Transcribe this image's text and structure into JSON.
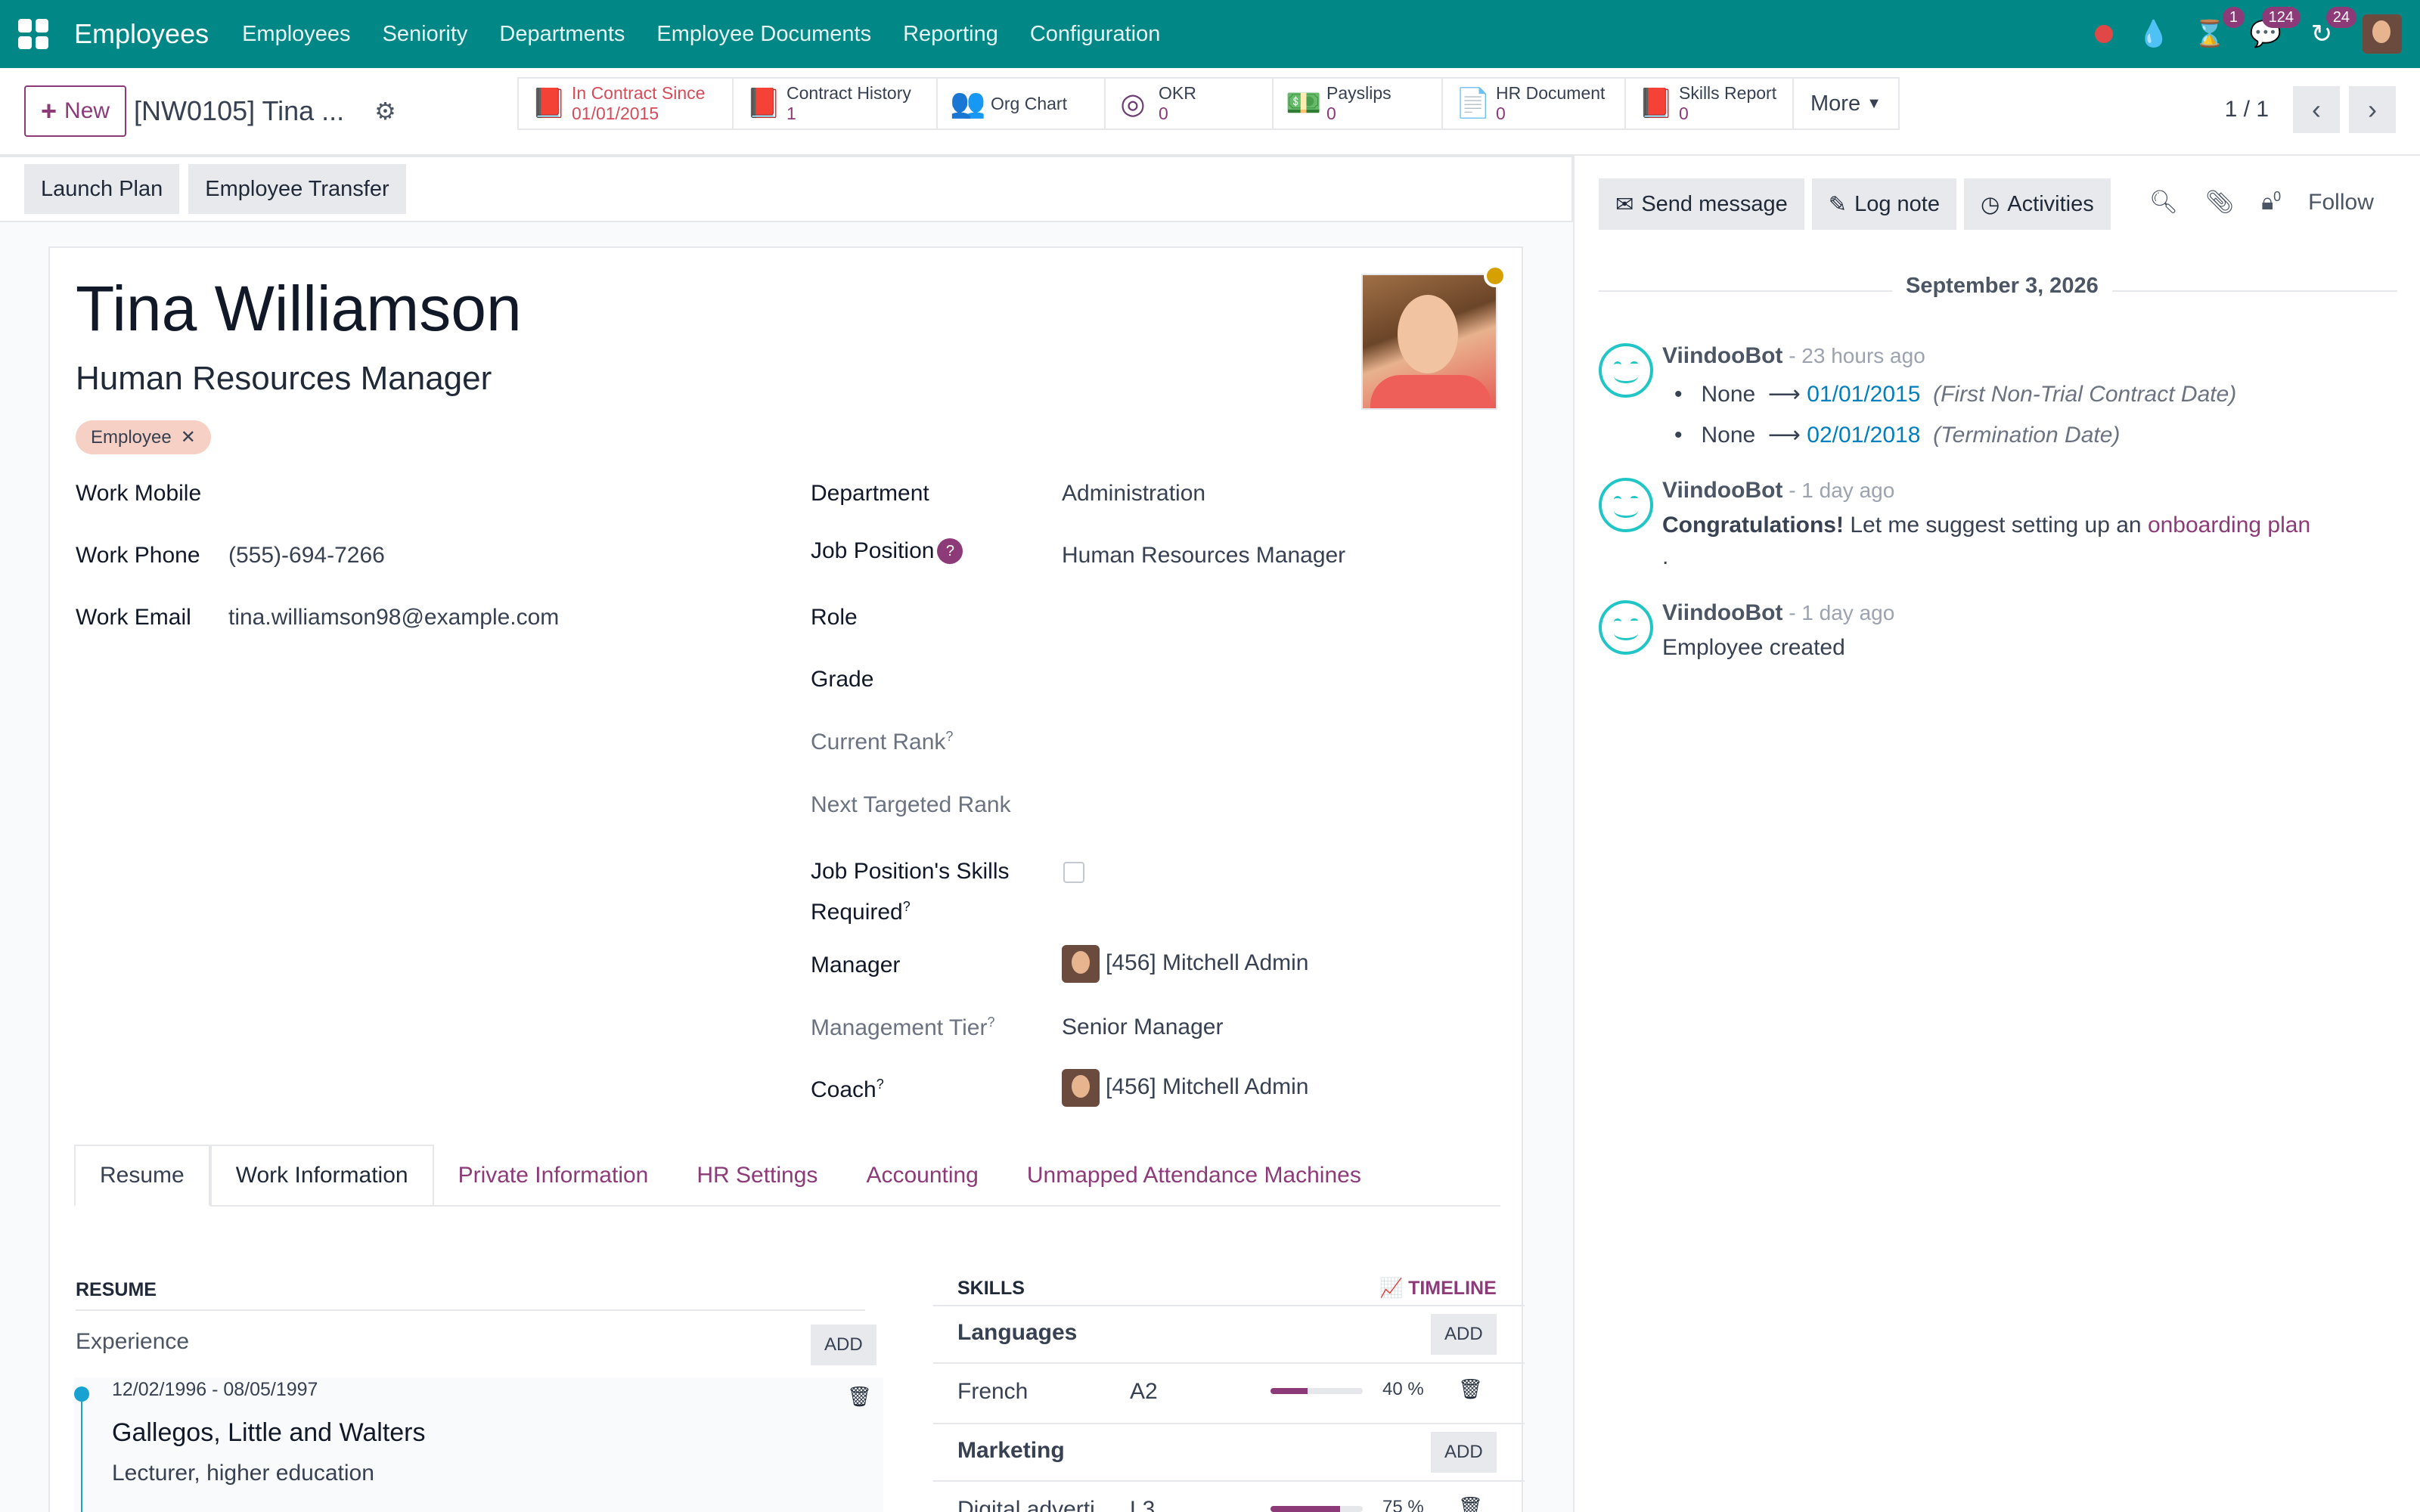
{
  "navbar": {
    "app_name": "Employees",
    "menu": [
      "Employees",
      "Seniority",
      "Departments",
      "Employee Documents",
      "Reporting",
      "Configuration"
    ],
    "badges": {
      "activities": "1",
      "messages": "124",
      "updates": "24"
    },
    "accent": "#018786"
  },
  "control": {
    "new_label": "New",
    "record_title": "[NW0105] Tina ...",
    "smart_buttons": [
      {
        "icon": "book-icon",
        "label": "In Contract Since",
        "value": "01/01/2015"
      },
      {
        "icon": "book-icon",
        "label": "Contract History",
        "value": "1"
      },
      {
        "icon": "users-icon",
        "label": "Org Chart",
        "value": ""
      },
      {
        "icon": "target-icon",
        "label": "OKR",
        "value": "0"
      },
      {
        "icon": "money-icon",
        "label": "Payslips",
        "value": "0"
      },
      {
        "icon": "file-icon",
        "label": "HR Document",
        "value": "0"
      },
      {
        "icon": "book-icon",
        "label": "Skills Report",
        "value": "0"
      }
    ],
    "more_label": "More",
    "pager": "1 / 1"
  },
  "statusbar": {
    "launch_plan": "Launch Plan",
    "employee_transfer": "Employee Transfer"
  },
  "employee": {
    "name": "Tina Williamson",
    "job_title": "Human Resources Manager",
    "tag": "Employee"
  },
  "fields_left": {
    "work_mobile_label": "Work Mobile",
    "work_phone_label": "Work Phone",
    "work_phone": "(555)-694-7266",
    "work_email_label": "Work Email",
    "work_email": "tina.williamson98@example.com"
  },
  "fields_right": {
    "department_label": "Department",
    "department": "Administration",
    "job_position_label": "Job Position",
    "job_position": "Human Resources Manager",
    "role_label": "Role",
    "grade_label": "Grade",
    "current_rank_label": "Current Rank",
    "next_rank_label": "Next Targeted Rank",
    "skills_required_label_1": "Job Position's Skills",
    "skills_required_label_2": "Required",
    "manager_label": "Manager",
    "manager": "[456] Mitchell Admin",
    "management_tier_label": "Management Tier",
    "management_tier": "Senior Manager",
    "coach_label": "Coach",
    "coach": "[456] Mitchell Admin"
  },
  "tabs": [
    "Resume",
    "Work Information",
    "Private Information",
    "HR Settings",
    "Accounting",
    "Unmapped Attendance Machines"
  ],
  "resume": {
    "heading": "RESUME",
    "experience_label": "Experience",
    "add_label": "ADD",
    "entry": {
      "dates": "12/02/1996 - 08/05/1997",
      "company": "Gallegos, Little and Walters",
      "role": "Lecturer, higher education"
    }
  },
  "skills": {
    "heading": "SKILLS",
    "timeline_label": "TIMELINE",
    "groups": [
      {
        "name": "Languages",
        "add": "ADD",
        "rows": [
          {
            "skill": "French",
            "level": "A2",
            "progress": 40,
            "percent": "40 %"
          }
        ]
      },
      {
        "name": "Marketing",
        "add": "ADD",
        "rows": [
          {
            "skill": "Digital adverti...",
            "level": "L3",
            "progress": 75,
            "percent": "75 %"
          }
        ]
      }
    ]
  },
  "chatter": {
    "send_message": "Send message",
    "log_note": "Log note",
    "activities": "Activities",
    "followers_count": "0",
    "follow_label": "Follow",
    "date": "September 3, 2026",
    "messages": [
      {
        "author": "ViindooBot",
        "when": " - 23 hours ago",
        "changes": [
          {
            "old": "None",
            "new": "01/01/2015",
            "field": "(First Non-Trial Contract Date)"
          },
          {
            "old": "None",
            "new": "02/01/2018",
            "field": "(Termination Date)"
          }
        ]
      },
      {
        "author": "ViindooBot",
        "when": " - 1 day ago",
        "bold": "Congratulations!",
        "text": " Let me suggest setting up an ",
        "link": "onboarding plan",
        "tail": "."
      },
      {
        "author": "ViindooBot",
        "when": " - 1 day ago",
        "text": "Employee created"
      }
    ]
  }
}
